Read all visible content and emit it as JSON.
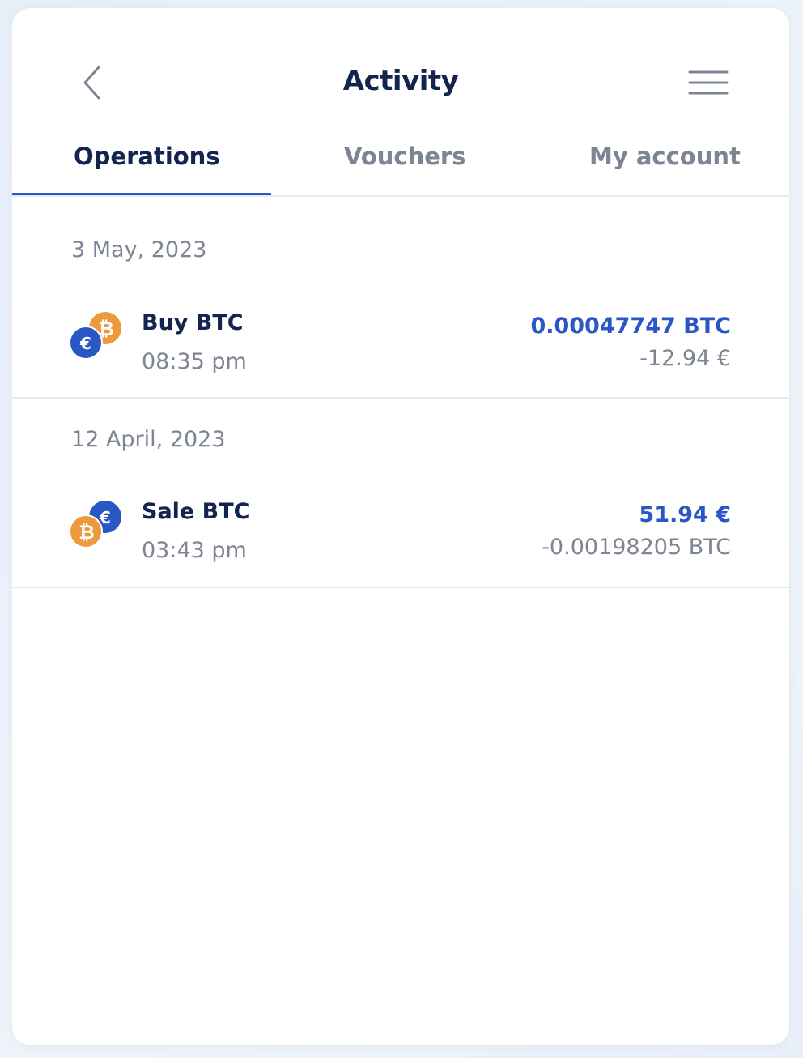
{
  "header": {
    "title": "Activity",
    "back_icon": "chevron-left-icon",
    "menu_icon": "hamburger-menu-icon"
  },
  "tabs": [
    {
      "label": "Operations",
      "active": true
    },
    {
      "label": "Vouchers",
      "active": false
    },
    {
      "label": "My account",
      "active": false
    }
  ],
  "groups": [
    {
      "date": "3 May, 2023",
      "transactions": [
        {
          "name": "Buy BTC",
          "time": "08:35 pm",
          "primary_amount": "0.00047747 BTC",
          "secondary_amount": "-12.94 €",
          "icon": "eur-to-btc-icon"
        }
      ]
    },
    {
      "date": "12 April, 2023",
      "transactions": [
        {
          "name": "Sale BTC",
          "time": "03:43 pm",
          "primary_amount": "51.94 €",
          "secondary_amount": "-0.00198205 BTC",
          "icon": "btc-to-eur-icon"
        }
      ]
    }
  ],
  "colors": {
    "accent": "#2a56c6",
    "title": "#13254f",
    "muted": "#7d8492",
    "btc": "#ec9a3c",
    "eur": "#2a56c6"
  }
}
